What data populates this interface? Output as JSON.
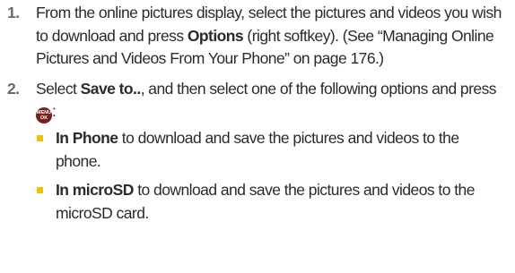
{
  "steps": [
    {
      "number": "1.",
      "text_a": "From the online pictures display, select the pictures and videos you wish to download and press ",
      "bold": "Options",
      "text_b": " (right softkey). (See “Managing Online Pictures and Videos From Your Phone” on page 176.)"
    },
    {
      "number": "2.",
      "text_a": "Select ",
      "bold": "Save to..",
      "text_b": ", and then select one of the following options and press ",
      "key_top": "MENU",
      "key_bottom": "OK",
      "text_c": ":",
      "bullets": [
        {
          "bold": "In Phone",
          "text": " to download and save the pictures and videos to the phone."
        },
        {
          "bold": "In microSD",
          "text": " to download and save the pictures and videos to the microSD card."
        }
      ]
    }
  ],
  "colors": {
    "text": "#2b2b2b",
    "step_number": "#6a6a6a",
    "bullet": "#f2c200",
    "menu_key": "#7c1f1f"
  }
}
